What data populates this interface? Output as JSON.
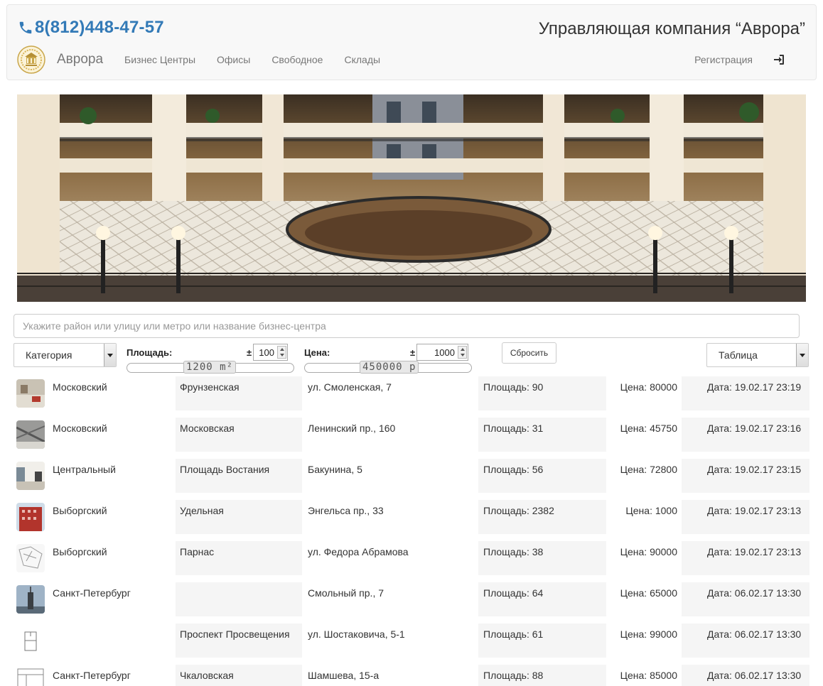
{
  "header": {
    "phone": "8(812)448-47-57",
    "company": "Управляющая компания “Аврора”",
    "brand": "Аврора",
    "nav": [
      "Бизнес Центры",
      "Офисы",
      "Свободное",
      "Склады"
    ],
    "register": "Регистрация",
    "login_icon": "sign-in-icon",
    "phone_icon": "phone-icon"
  },
  "search": {
    "placeholder": "Укажите район или улицу или метро или название бизнес-центра"
  },
  "filters": {
    "category": "Категория",
    "area_label": "Площадь:",
    "area_pm": "±",
    "area_delta": "100",
    "area_value": "1200 m²",
    "price_label": "Цена:",
    "price_pm": "±",
    "price_delta": "1000",
    "price_value": "450000 р",
    "reset": "Сбросить",
    "view": "Таблица"
  },
  "listings": [
    {
      "district": "Московский",
      "metro": "Фрунзенская",
      "address": "ул. Смоленская, 7",
      "area": "Площадь: 90",
      "price": "Цена: 80000",
      "date": "Дата: 19.02.17 23:19"
    },
    {
      "district": "Московский",
      "metro": "Московская",
      "address": "Ленинский пр., 160",
      "area": "Площадь: 31",
      "price": "Цена: 45750",
      "date": "Дата: 19.02.17 23:16"
    },
    {
      "district": "Центральный",
      "metro": "Площадь Востания",
      "address": "Бакунина, 5",
      "area": "Площадь: 56",
      "price": "Цена: 72800",
      "date": "Дата: 19.02.17 23:15"
    },
    {
      "district": "Выборгский",
      "metro": "Удельная",
      "address": "Энгельса пр., 33",
      "area": "Площадь: 2382",
      "price": "Цена: 1000",
      "date": "Дата: 19.02.17 23:13"
    },
    {
      "district": "Выборгский",
      "metro": "Парнас",
      "address": "ул. Федора Абрамова",
      "area": "Площадь: 38",
      "price": "Цена: 90000",
      "date": "Дата: 19.02.17 23:13"
    },
    {
      "district": "Санкт-Петербург",
      "metro": "",
      "address": "Смольный пр., 7",
      "area": "Площадь: 64",
      "price": "Цена: 65000",
      "date": "Дата: 06.02.17 13:30"
    },
    {
      "district": "",
      "metro": "Проспект Просвещения",
      "address": "ул. Шостаковича, 5-1",
      "area": "Площадь: 61",
      "price": "Цена: 99000",
      "date": "Дата: 06.02.17 13:30"
    },
    {
      "district": "Санкт-Петербург",
      "metro": "Чкаловская",
      "address": "Шамшева, 15-а",
      "area": "Площадь: 88",
      "price": "Цена: 85000",
      "date": "Дата: 06.02.17 13:30"
    }
  ]
}
